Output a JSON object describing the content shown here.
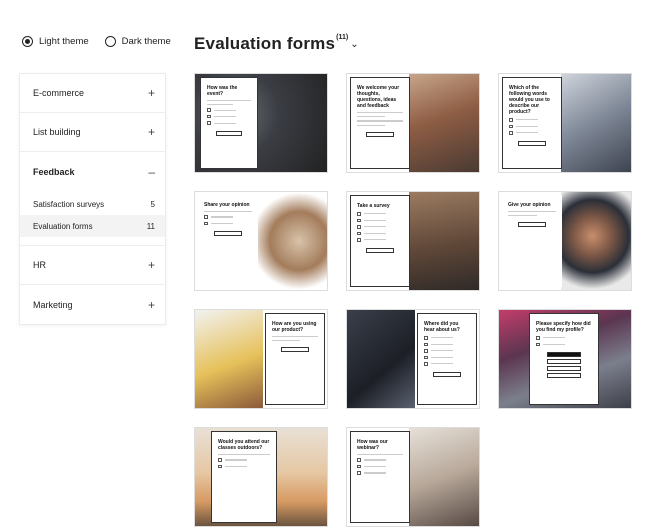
{
  "theme": {
    "light": "Light theme",
    "dark": "Dark theme",
    "selected": "light"
  },
  "sidebar": {
    "items": [
      {
        "label": "E-commerce",
        "icon": "plus-icon"
      },
      {
        "label": "List building",
        "icon": "plus-icon"
      },
      {
        "label": "Feedback",
        "icon": "minus-icon",
        "subitems": [
          {
            "label": "Satisfaction surveys",
            "count": "5"
          },
          {
            "label": "Evaluation forms",
            "count": "11"
          }
        ]
      },
      {
        "label": "HR",
        "icon": "plus-icon"
      },
      {
        "label": "Marketing",
        "icon": "plus-icon"
      }
    ]
  },
  "header": {
    "title": "Evaluation forms",
    "count": "(11)"
  },
  "cards": [
    {
      "title": "How was the event?"
    },
    {
      "title": "We welcome your thoughts, questions, ideas and feedback"
    },
    {
      "title": "Which of the following words would you use to describe our product?"
    },
    {
      "title": "Share your opinion"
    },
    {
      "title": "Take a survey"
    },
    {
      "title": "Give your opinion"
    },
    {
      "title": "How are you using our product?"
    },
    {
      "title": "Where did you hear about us?"
    },
    {
      "title": "Please specify how did you find my profile?"
    },
    {
      "title": "Would you attend our classes outdoors?"
    },
    {
      "title": "How was our webinar?"
    }
  ],
  "colors": {
    "accent": "#222222",
    "selected_bg": "#f3f3f3",
    "border": "#dddddd"
  }
}
